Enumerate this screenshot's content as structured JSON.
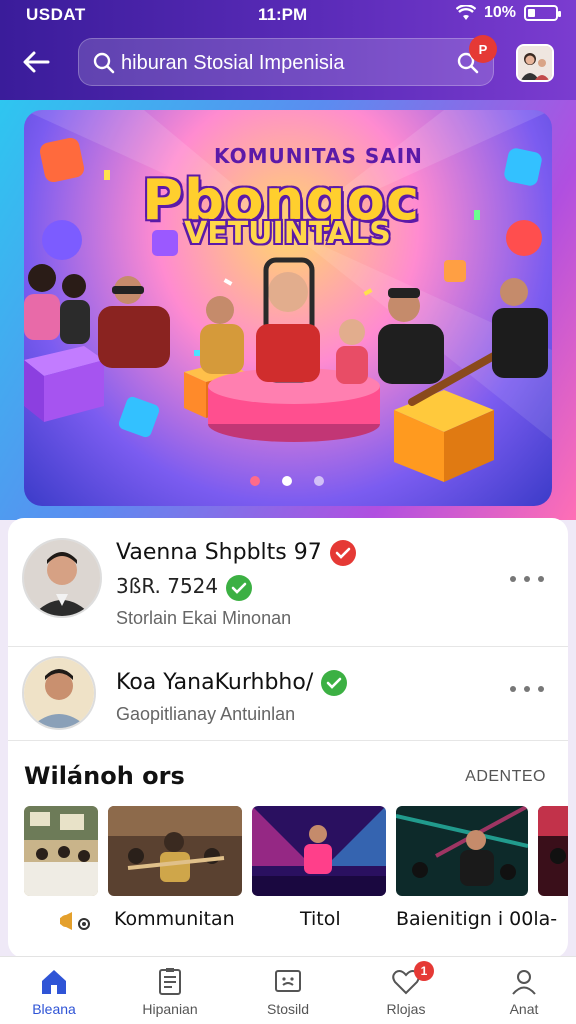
{
  "status": {
    "carrier": "USDAT",
    "time": "11:PM",
    "battery_text": "10%",
    "battery_level": 0.25
  },
  "header": {
    "search_value": "hiburan Stosial Impenisia",
    "search_badge": "P",
    "icons": [
      "back-arrow-icon",
      "search-icon",
      "avatar"
    ]
  },
  "banner": {
    "title_small": "KOMUNITAS SAIN",
    "title_big": "Pbongoc",
    "title_sub": "VETUINTALS",
    "slides": 3,
    "active_slide": 2
  },
  "users": [
    {
      "name": "Vaenna Shpblts 97",
      "stat": "3ßR. 7524",
      "subtitle": "Storlain Ekai Minonan",
      "badge_color": "#e53935"
    },
    {
      "name": "Koa YanaKurhbho/",
      "subtitle": "Gaopitlianay Antuinlan",
      "badge_color": "#3cb043"
    }
  ],
  "section": {
    "title": "Wilánoh ors",
    "link": "ADENTEO"
  },
  "thumb_labels": [
    "Kommunitan",
    "Titol",
    "Baienitign i 00la-"
  ],
  "nav": [
    {
      "label": "Bleana",
      "icon": "home-icon",
      "active": true
    },
    {
      "label": "Hipanian",
      "icon": "document-icon",
      "active": false
    },
    {
      "label": "Stosild",
      "icon": "chat-box-icon",
      "active": false
    },
    {
      "label": "Rlojas",
      "icon": "heart-icon",
      "active": false,
      "badge": "1"
    },
    {
      "label": "Anat",
      "icon": "profile-icon",
      "active": false
    }
  ],
  "colors": {
    "header": "#3a1c9a",
    "accent": "#2f54d6",
    "badge_red": "#e53935",
    "verify_green": "#3cb043"
  }
}
